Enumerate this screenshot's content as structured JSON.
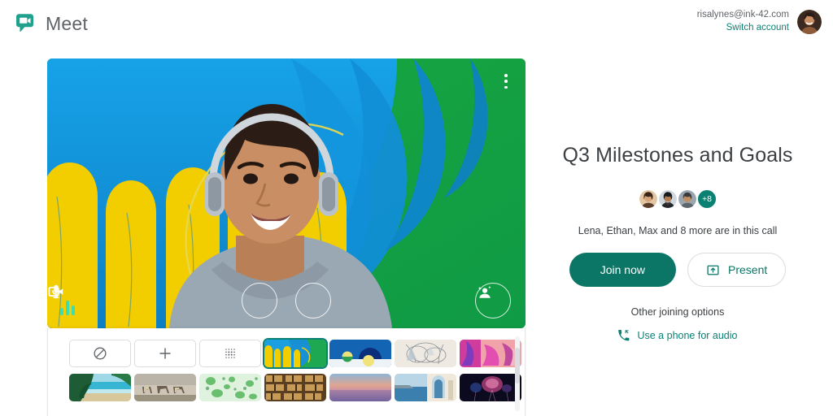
{
  "header": {
    "brand_name": "Meet",
    "brand_logo_icon": "meet-video-bubble-icon",
    "account_email": "risalynes@ink-42.com",
    "switch_account_label": "Switch account",
    "avatar_icon": "user-avatar"
  },
  "stage": {
    "menu_icon": "more-vertical-icon",
    "audio_meter_icon": "audio-level-icon",
    "controls": [
      {
        "name": "microphone",
        "icon": "microphone-icon"
      },
      {
        "name": "camera",
        "icon": "video-camera-icon"
      }
    ],
    "effects_button": {
      "name": "visual-effects",
      "icon": "effects-sparkle-person-icon"
    },
    "background": {
      "base_color": "#16a34a",
      "blue": "#1a9fe0",
      "yellow": "#f2cd00",
      "green": "#16a34a",
      "accent_line": "#e8d44d"
    }
  },
  "effects_panel": {
    "scrollbar": "vertical-scrollbar",
    "items": [
      {
        "name": "no-effect",
        "kind": "glyph",
        "icon": "no-effect-slash-icon",
        "selected": false
      },
      {
        "name": "add-background",
        "kind": "glyph",
        "icon": "plus-icon",
        "selected": false
      },
      {
        "name": "blur-background",
        "kind": "glyph",
        "icon": "blur-dots-icon",
        "selected": false
      },
      {
        "name": "bg-yellow-blue-swirl",
        "kind": "art",
        "art": "swirl",
        "selected": true
      },
      {
        "name": "bg-blue-spheres",
        "kind": "art",
        "art": "spheres",
        "selected": false
      },
      {
        "name": "bg-line-art",
        "kind": "art",
        "art": "lines",
        "selected": false
      },
      {
        "name": "bg-pink-abstract",
        "kind": "art",
        "art": "pink",
        "selected": false
      },
      {
        "name": "bg-tropical-beach",
        "kind": "art",
        "art": "beach",
        "selected": false
      },
      {
        "name": "bg-horses",
        "kind": "art",
        "art": "horses",
        "selected": false
      },
      {
        "name": "bg-green-watercolor",
        "kind": "art",
        "art": "watercolor",
        "selected": false
      },
      {
        "name": "bg-bookshelf",
        "kind": "art",
        "art": "books",
        "selected": false
      },
      {
        "name": "bg-sunset-gradient",
        "kind": "art",
        "art": "sunset",
        "selected": false
      },
      {
        "name": "bg-santorini",
        "kind": "art",
        "art": "santorini",
        "selected": false
      },
      {
        "name": "bg-fireworks",
        "kind": "art",
        "art": "fireworks",
        "selected": false
      }
    ]
  },
  "join": {
    "title": "Q3 Milestones and Goals",
    "participants_overflow": "+8",
    "participants_text": "Lena, Ethan, Max and 8 more are in this call",
    "join_label": "Join now",
    "present_label": "Present",
    "present_icon": "present-screen-icon",
    "other_options_label": "Other joining options",
    "phone_audio_label": "Use a phone for audio",
    "phone_icon": "phone-dial-icon"
  },
  "colors": {
    "brand_teal": "#0b8174",
    "join_button": "#0b7566",
    "text_primary": "#3c4043",
    "text_secondary": "#5f6368",
    "border": "#dadce0"
  }
}
